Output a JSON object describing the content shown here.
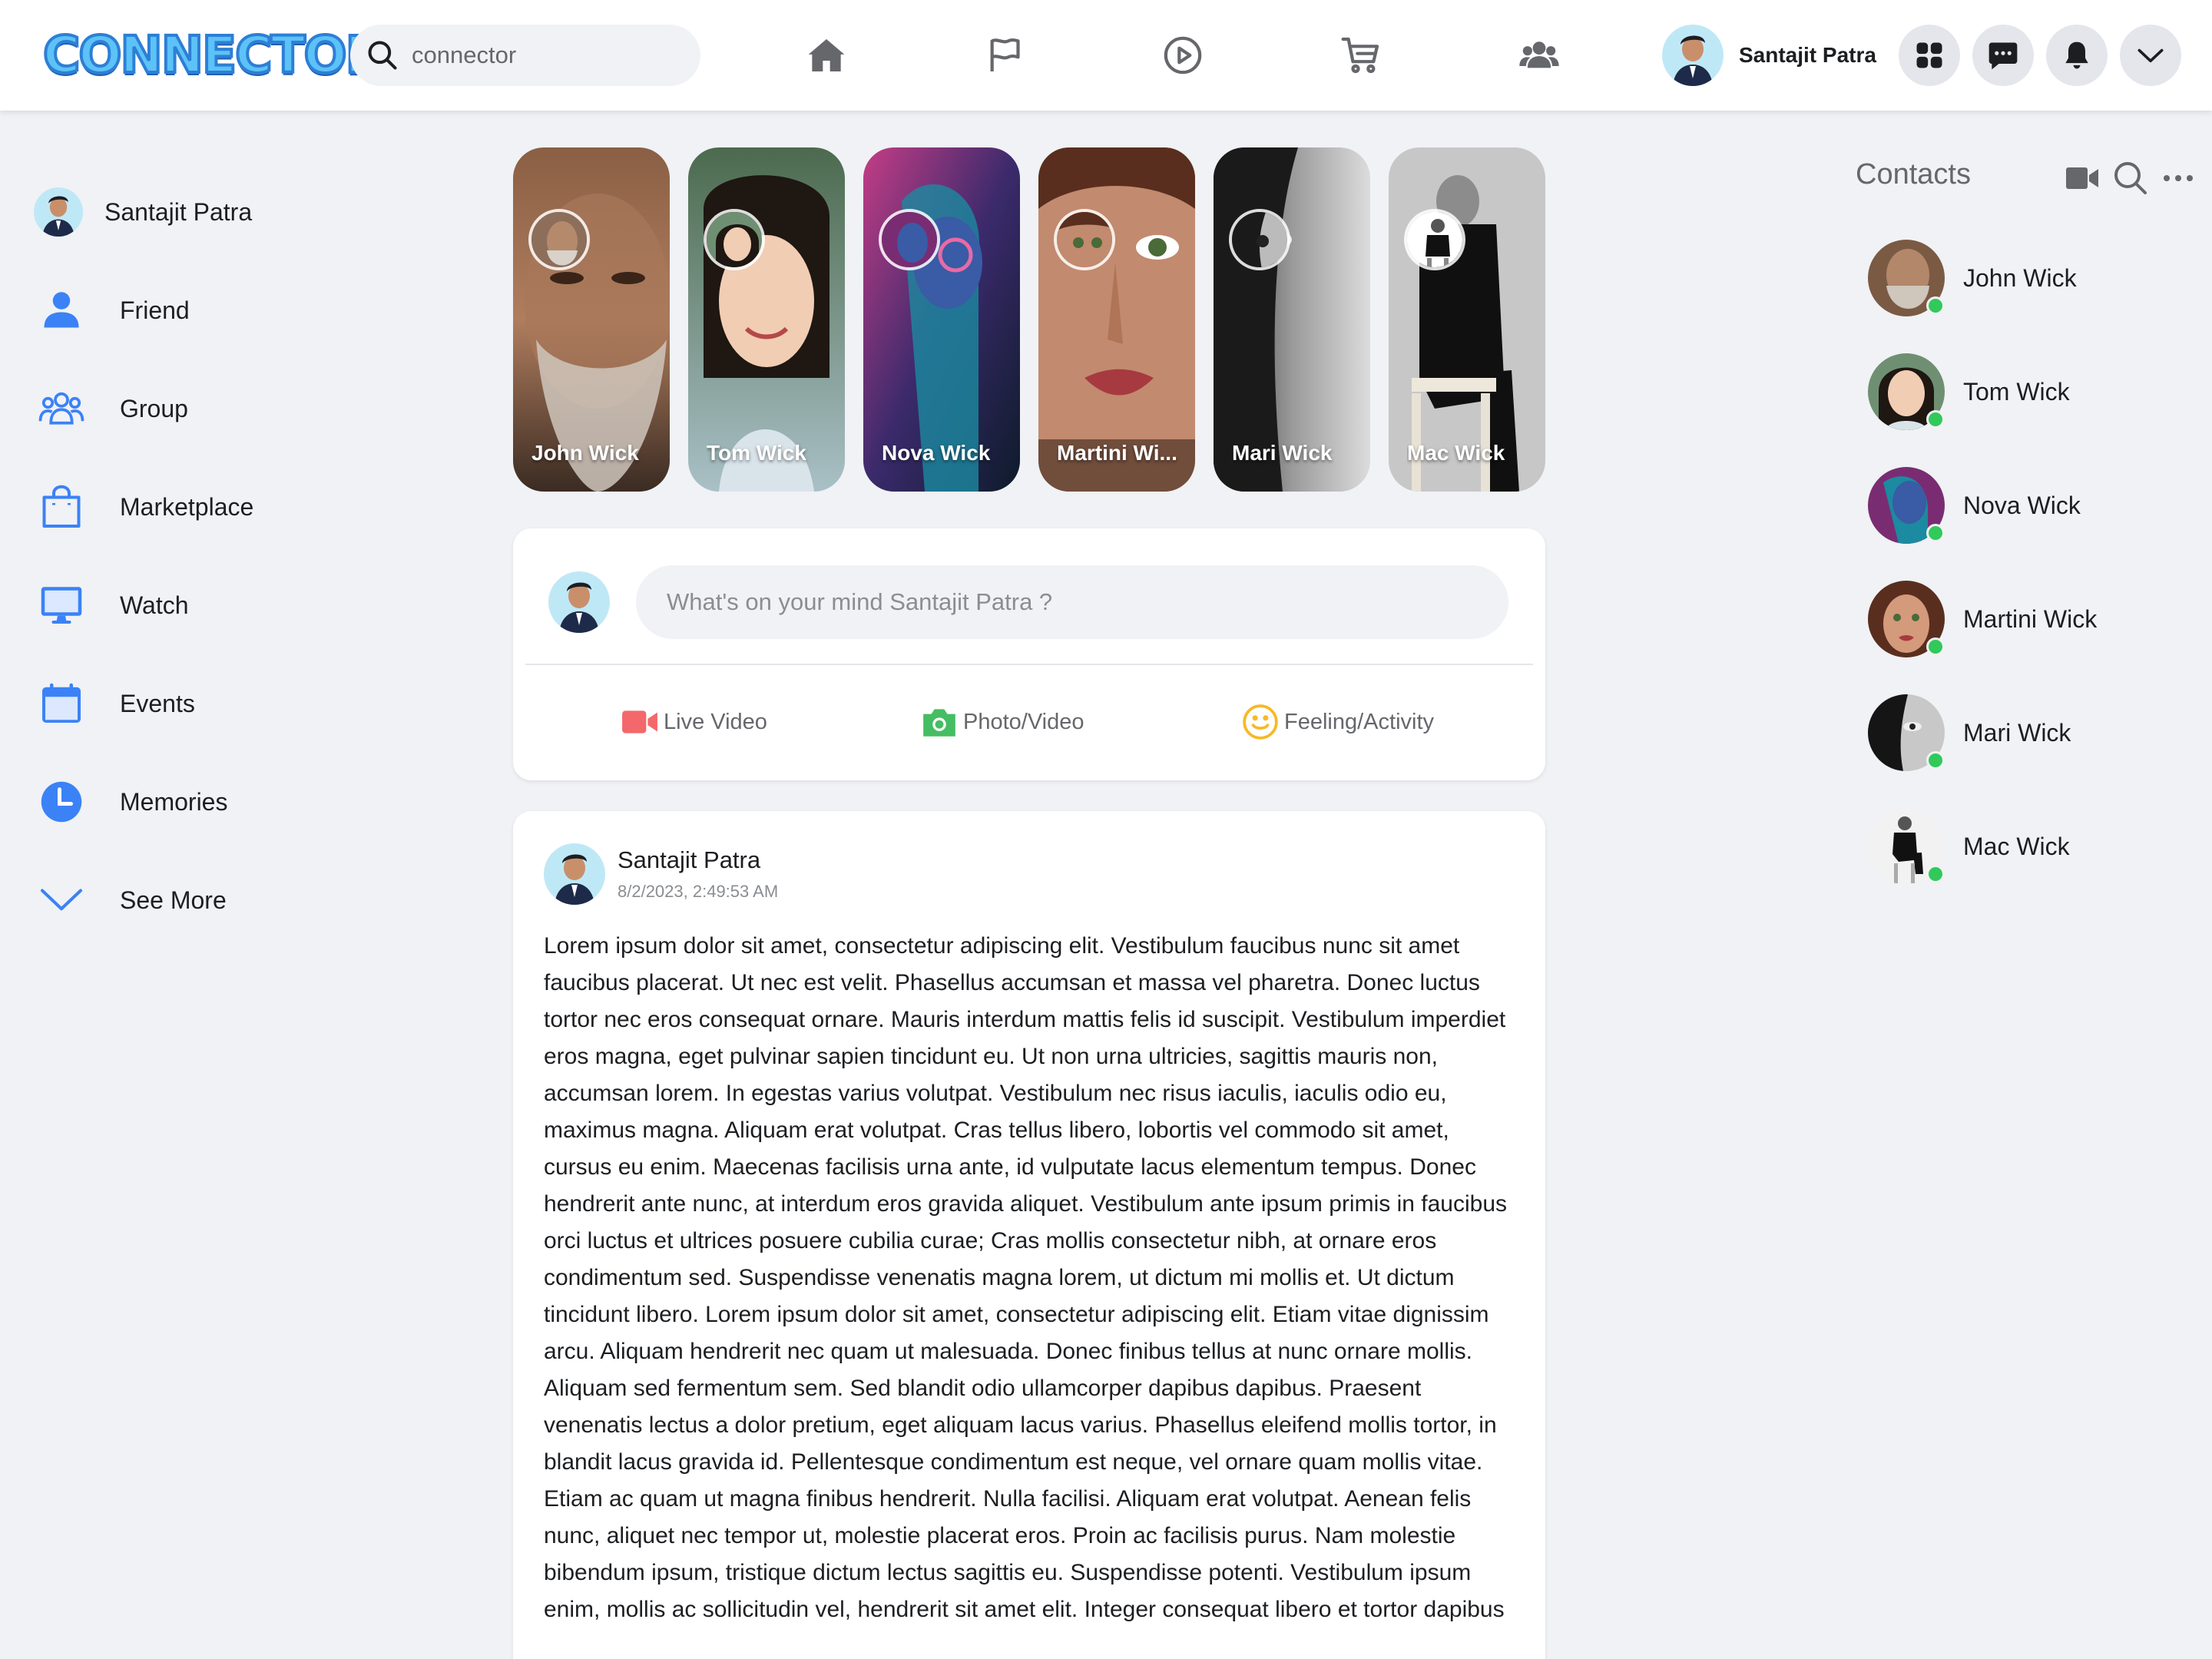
{
  "app": {
    "logo_text": "CONNECTOR",
    "search": {
      "value": "connector"
    }
  },
  "header": {
    "user_name": "Santajit Patra"
  },
  "sidebar": {
    "user_name": "Santajit Patra",
    "items": [
      {
        "label": "Friend",
        "icon": "user-icon"
      },
      {
        "label": "Group",
        "icon": "group-icon"
      },
      {
        "label": "Marketplace",
        "icon": "shopping-bag-icon"
      },
      {
        "label": "Watch",
        "icon": "monitor-icon"
      },
      {
        "label": "Events",
        "icon": "calendar-icon"
      },
      {
        "label": "Memories",
        "icon": "clock-icon"
      },
      {
        "label": "See More",
        "icon": "chevron-down-icon"
      }
    ]
  },
  "stories": [
    {
      "name": "John Wick"
    },
    {
      "name": "Tom Wick"
    },
    {
      "name": "Nova Wick"
    },
    {
      "name": "Martini Wi..."
    },
    {
      "name": "Mari Wick"
    },
    {
      "name": "Mac Wick"
    }
  ],
  "composer": {
    "placeholder": "What's on your mind Santajit Patra ?",
    "actions": [
      {
        "label": "Live Video",
        "icon": "video-icon",
        "color": "#f3686a"
      },
      {
        "label": "Photo/Video",
        "icon": "camera-icon",
        "color": "#45bd62"
      },
      {
        "label": "Feeling/Activity",
        "icon": "smile-icon",
        "color": "#f7b928"
      }
    ]
  },
  "post": {
    "author": "Santajit Patra",
    "timestamp": "8/2/2023, 2:49:53 AM",
    "body": "Lorem ipsum dolor sit amet, consectetur adipiscing elit. Vestibulum faucibus nunc sit amet faucibus placerat. Ut nec est velit. Phasellus accumsan et massa vel pharetra. Donec luctus tortor nec eros consequat ornare. Mauris interdum mattis felis id suscipit. Vestibulum imperdiet eros magna, eget pulvinar sapien tincidunt eu. Ut non urna ultricies, sagittis mauris non, accumsan lorem. In egestas varius volutpat. Vestibulum nec risus iaculis, iaculis odio eu, maximus magna. Aliquam erat volutpat. Cras tellus libero, lobortis vel commodo sit amet, cursus eu enim. Maecenas facilisis urna ante, id vulputate lacus elementum tempus. Donec hendrerit ante nunc, at interdum eros gravida aliquet. Vestibulum ante ipsum primis in faucibus orci luctus et ultrices posuere cubilia curae; Cras mollis consectetur nibh, at ornare eros condimentum sed. Suspendisse venenatis magna lorem, ut dictum mi mollis et. Ut dictum tincidunt libero. Lorem ipsum dolor sit amet, consectetur adipiscing elit. Etiam vitae dignissim arcu. Aliquam hendrerit nec quam ut malesuada. Donec finibus tellus at nunc ornare mollis. Aliquam sed fermentum sem. Sed blandit odio ullamcorper dapibus dapibus. Praesent venenatis lectus a dolor pretium, eget aliquam lacus varius. Phasellus eleifend mollis tortor, in blandit lacus gravida id. Pellentesque condimentum est neque, vel ornare quam mollis vitae. Etiam ac quam ut magna finibus hendrerit. Nulla facilisi. Aliquam erat volutpat. Aenean felis nunc, aliquet nec tempor ut, molestie placerat eros. Proin ac facilisis purus. Nam molestie bibendum ipsum, tristique dictum lectus sagittis eu. Suspendisse potenti. Vestibulum ipsum enim, mollis ac sollicitudin vel, hendrerit sit amet elit. Integer consequat libero et tortor dapibus"
  },
  "contacts": {
    "title": "Contacts",
    "items": [
      {
        "name": "John Wick",
        "status": "online"
      },
      {
        "name": "Tom Wick",
        "status": "online"
      },
      {
        "name": "Nova Wick",
        "status": "online"
      },
      {
        "name": "Martini Wick",
        "status": "online"
      },
      {
        "name": "Mari Wick",
        "status": "online"
      },
      {
        "name": "Mac Wick",
        "status": "online"
      }
    ]
  },
  "colors": {
    "accent": "#1877f2",
    "icon_blue": "#3b82f6",
    "nav_gray": "#65676b",
    "online": "#31c95a",
    "background": "#f0f2f5"
  }
}
